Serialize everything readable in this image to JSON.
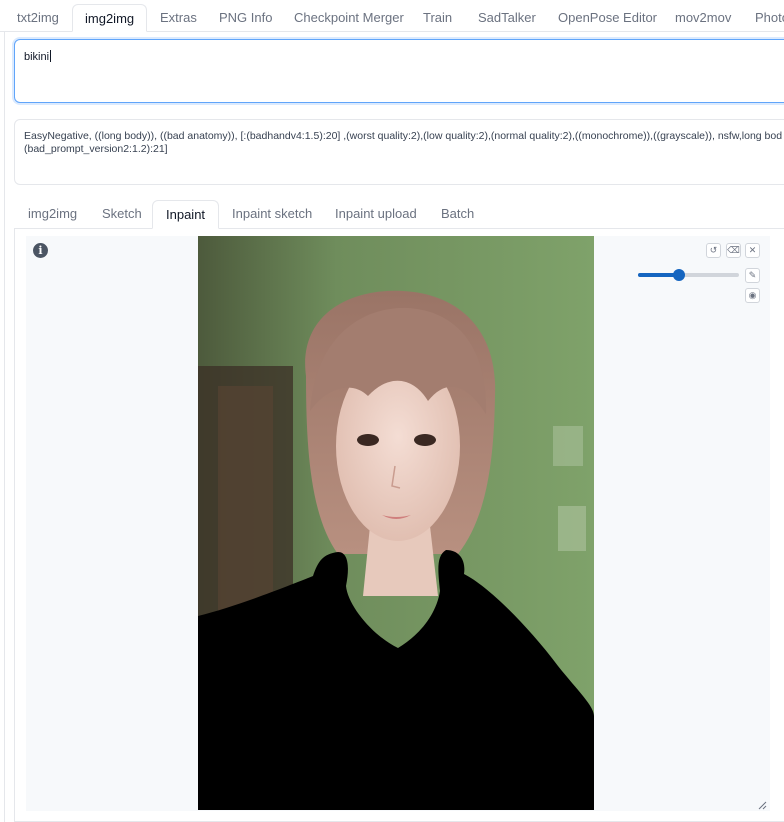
{
  "top_tabs": [
    "txt2img",
    "img2img",
    "Extras",
    "PNG Info",
    "Checkpoint Merger",
    "Train",
    "SadTalker",
    "OpenPose Editor",
    "mov2mov",
    "Photo"
  ],
  "active_top_tab": "img2img",
  "prompt": {
    "value": "bikini"
  },
  "negative_prompt": {
    "line1": "EasyNegative, ((long body)), ((bad anatomy)), [:(badhandv4:1.5):20] ,(worst quality:2),(low quality:2),(normal quality:2),((monochrome)),((grayscale)), nsfw,long bod",
    "line2": "(bad_prompt_version2:1.2):21]"
  },
  "sub_tabs": [
    "img2img",
    "Sketch",
    "Inpaint",
    "Inpaint sketch",
    "Inpaint upload",
    "Batch"
  ],
  "active_sub_tab": "Inpaint",
  "brush_size_fraction": 0.41,
  "icons": {
    "info": "info-icon",
    "undo": "undo-icon",
    "clear": "eraser-icon",
    "close": "close-icon",
    "brush": "brush-icon",
    "palette": "palette-icon"
  },
  "colors": {
    "accent": "#1565c0",
    "focus_border": "#60a5fa",
    "mask": "#000000"
  }
}
